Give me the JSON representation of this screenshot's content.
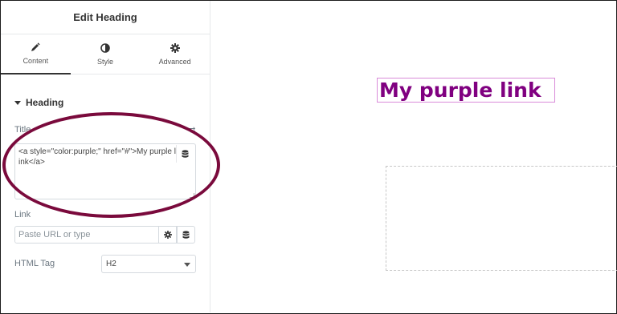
{
  "panel": {
    "title": "Edit Heading",
    "tabs": [
      {
        "label": "Content",
        "icon": "pencil-icon",
        "active": true
      },
      {
        "label": "Style",
        "icon": "contrast-icon",
        "active": false
      },
      {
        "label": "Advanced",
        "icon": "gear-icon",
        "active": false
      }
    ],
    "section": {
      "title": "Heading"
    },
    "title_field": {
      "label": "Title",
      "value": "<a style=\"color:purple;\" href=\"#\">My purple link</a>"
    },
    "link_field": {
      "label": "Link",
      "placeholder": "Paste URL or type"
    },
    "html_tag": {
      "label": "HTML Tag",
      "value": "H2"
    }
  },
  "preview": {
    "heading_text": "My purple link"
  },
  "colors": {
    "annotation_oval": "#7a0a3c",
    "link_color": "#800080"
  }
}
